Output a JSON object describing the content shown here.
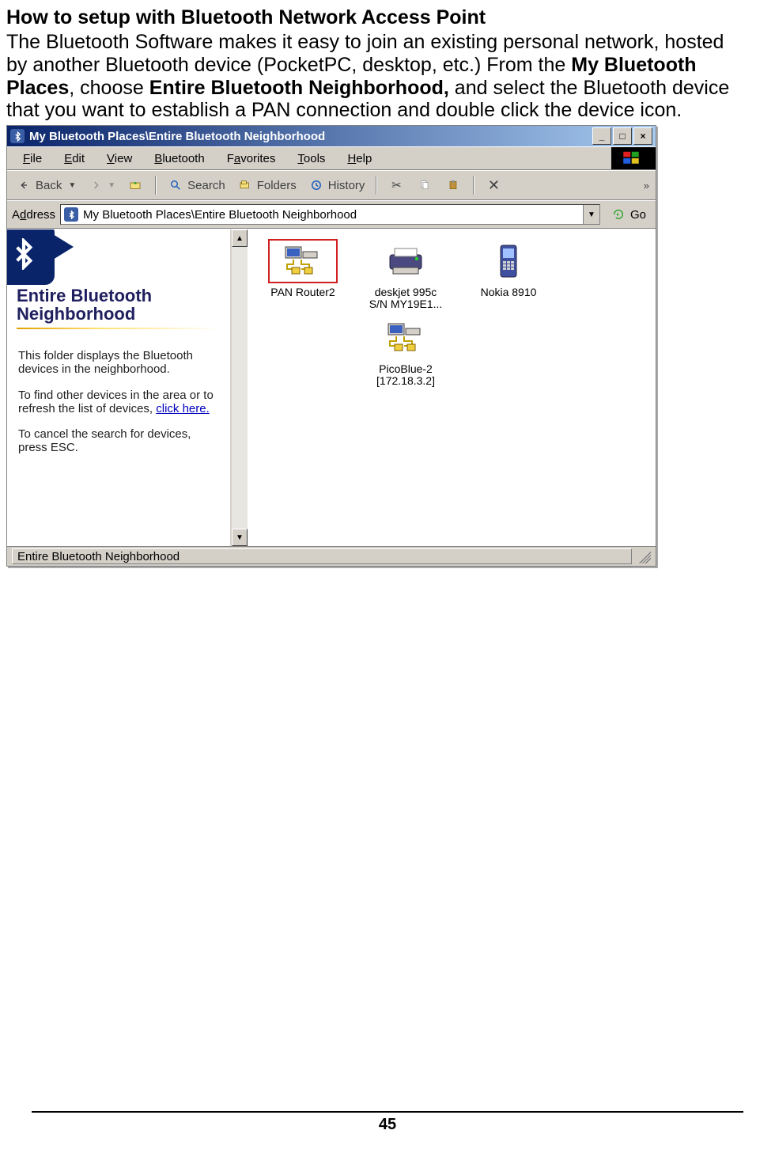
{
  "doc": {
    "heading": "How to setup with Bluetooth Network Access Point",
    "para_parts": [
      "The Bluetooth Software makes it easy to join an existing personal network, hosted by another Bluetooth device (PocketPC, desktop, etc.) From the ",
      "My Bluetooth Places",
      ", choose ",
      "Entire Bluetooth Neighborhood,",
      " and select the Bluetooth device that you want to establish a PAN connection and double click the device icon."
    ],
    "page_number": "45"
  },
  "window": {
    "title": "My Bluetooth Places\\Entire Bluetooth Neighborhood",
    "controls": {
      "min": "_",
      "max": "□",
      "close": "×"
    },
    "menu": [
      {
        "pre": "",
        "u": "F",
        "post": "ile"
      },
      {
        "pre": "",
        "u": "E",
        "post": "dit"
      },
      {
        "pre": "",
        "u": "V",
        "post": "iew"
      },
      {
        "pre": "",
        "u": "B",
        "post": "luetooth"
      },
      {
        "pre": "F",
        "u": "a",
        "post": "vorites"
      },
      {
        "pre": "",
        "u": "T",
        "post": "ools"
      },
      {
        "pre": "",
        "u": "H",
        "post": "elp"
      }
    ],
    "toolbar": {
      "back": "Back",
      "search": "Search",
      "folders": "Folders",
      "history": "History"
    },
    "address": {
      "label_pre": "A",
      "label_u": "d",
      "label_post": "dress",
      "value": "My Bluetooth Places\\Entire Bluetooth Neighborhood",
      "go": "Go"
    },
    "info_panel": {
      "title": "Entire Bluetooth Neighborhood",
      "p1": "This folder displays the Bluetooth devices in the neighborhood.",
      "p2a": "To find other devices in the area or to refresh the list of devices, ",
      "p2link": "click here.",
      "p3": "To cancel the search for devices, press ESC."
    },
    "devices": [
      {
        "name": "PAN Router2",
        "sub": "",
        "kind": "pan",
        "selected": true
      },
      {
        "name": "deskjet 995c",
        "sub": "S/N MY19E1...",
        "kind": "printer",
        "selected": false
      },
      {
        "name": "Nokia 8910",
        "sub": "",
        "kind": "phone",
        "selected": false
      },
      {
        "name": "PicoBlue-2",
        "sub": "[172.18.3.2]",
        "kind": "pan",
        "selected": false
      }
    ],
    "status": "Entire Bluetooth Neighborhood"
  }
}
